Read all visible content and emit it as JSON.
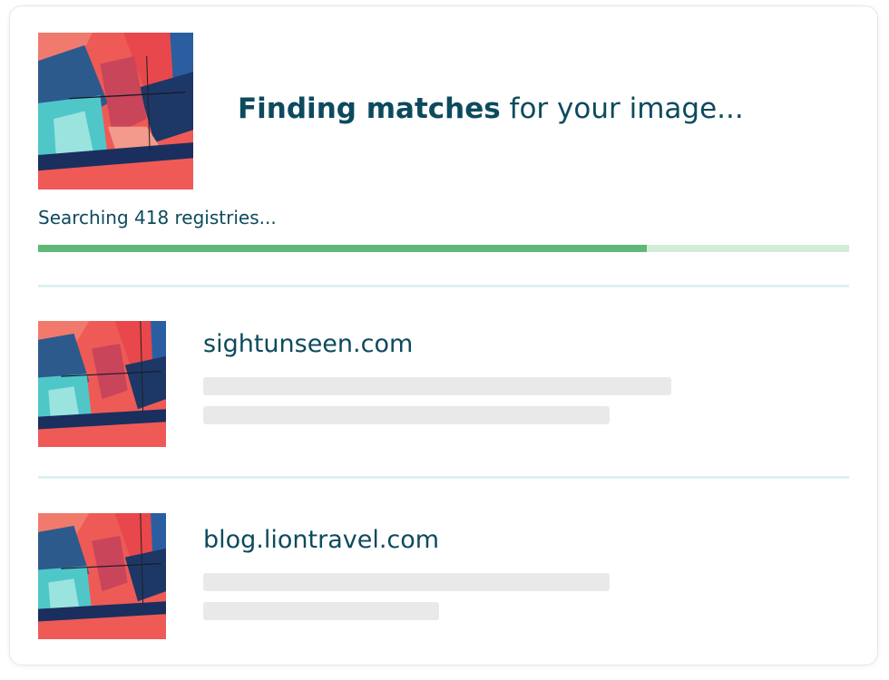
{
  "header": {
    "title_bold": "Finding matches",
    "title_rest": " for your image...",
    "image_icon": "uploaded-image-thumbnail"
  },
  "search": {
    "status_text": "Searching 418 registries...",
    "progress": 0.75
  },
  "results": [
    {
      "domain": "sightunseen.com",
      "image_icon": "match-image-thumbnail"
    },
    {
      "domain": "blog.liontravel.com",
      "image_icon": "match-image-thumbnail"
    }
  ],
  "colors": {
    "text": "#0d4a5e",
    "progress_fill": "#5fb877",
    "progress_track": "#d3ecd7",
    "divider": "#dff0f2",
    "skeleton": "#e9e9e9"
  }
}
